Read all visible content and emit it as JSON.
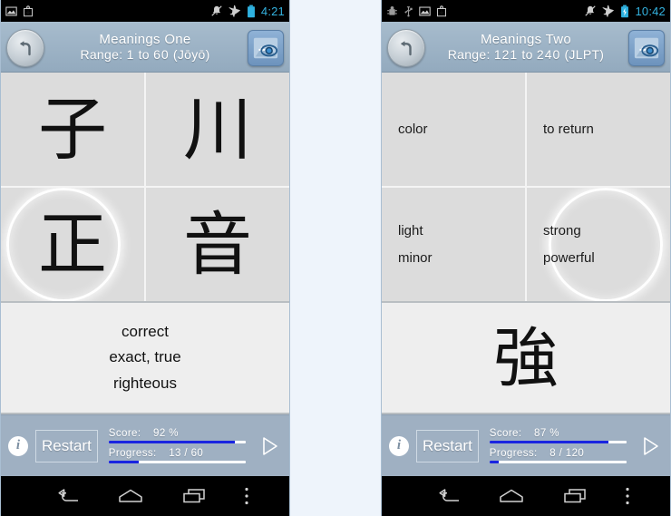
{
  "gap_background": "#eef4fb",
  "accent_blue": "#1a25e0",
  "header_color": "#9cb2c5",
  "toolbar_color": "#9fb0c2",
  "tile_color": "#dcdcdc",
  "phones": [
    {
      "status": {
        "icons": [
          "image-icon",
          "download-icon"
        ],
        "right_icons": [
          "ringer-muted-icon",
          "airplane-mode-icon",
          "battery-icon"
        ],
        "time": "4:21"
      },
      "header": {
        "back_label": "back-arrow-icon",
        "title": "Meanings One",
        "range_prefix": "Range:",
        "range_from": "1",
        "range_to_word": "to",
        "range_to": "60",
        "range_set": "(Jōyō)",
        "peek_icon": "peek-eye-icon"
      },
      "tiles": [
        {
          "type": "kanji",
          "text": "子",
          "selected": false
        },
        {
          "type": "kanji",
          "text": "川",
          "selected": false
        },
        {
          "type": "kanji",
          "text": "正",
          "selected": true
        },
        {
          "type": "kanji",
          "text": "音",
          "selected": false
        }
      ],
      "answer": {
        "type": "lines",
        "lines": [
          "correct",
          "exact, true",
          "righteous"
        ]
      },
      "toolbar": {
        "info_label": "i",
        "restart_label": "Restart",
        "score_label": "Score:",
        "score_value": "92 %",
        "score_percent": 92,
        "progress_label": "Progress:",
        "progress_value": "13 / 60",
        "progress_percent": 22,
        "play_icon": "play-triangle-icon"
      }
    },
    {
      "status": {
        "icons": [
          "android-debug-icon",
          "usb-icon",
          "image-icon",
          "download-icon"
        ],
        "right_icons": [
          "ringer-muted-icon",
          "airplane-mode-icon",
          "battery-charging-icon"
        ],
        "time": "10:42"
      },
      "header": {
        "back_label": "back-arrow-icon",
        "title": "Meanings Two",
        "range_prefix": "Range:",
        "range_from": "121",
        "range_to_word": "to",
        "range_to": "240",
        "range_set": "(JLPT)",
        "peek_icon": "peek-eye-icon"
      },
      "tiles": [
        {
          "type": "meaning",
          "text": "color",
          "selected": false
        },
        {
          "type": "meaning",
          "text": "to return",
          "selected": false
        },
        {
          "type": "meaning",
          "text": "light\nminor",
          "selected": false
        },
        {
          "type": "meaning",
          "text": "strong\npowerful",
          "selected": true
        }
      ],
      "answer": {
        "type": "kanji",
        "kanji": "強"
      },
      "toolbar": {
        "info_label": "i",
        "restart_label": "Restart",
        "score_label": "Score:",
        "score_value": "87 %",
        "score_percent": 87,
        "progress_label": "Progress:",
        "progress_value": "8 / 120",
        "progress_percent": 7,
        "play_icon": "play-triangle-icon"
      }
    }
  ],
  "navbar": {
    "back": "back-nav-icon",
    "home": "home-nav-icon",
    "recents": "recents-nav-icon",
    "menu": "overflow-menu-icon"
  }
}
